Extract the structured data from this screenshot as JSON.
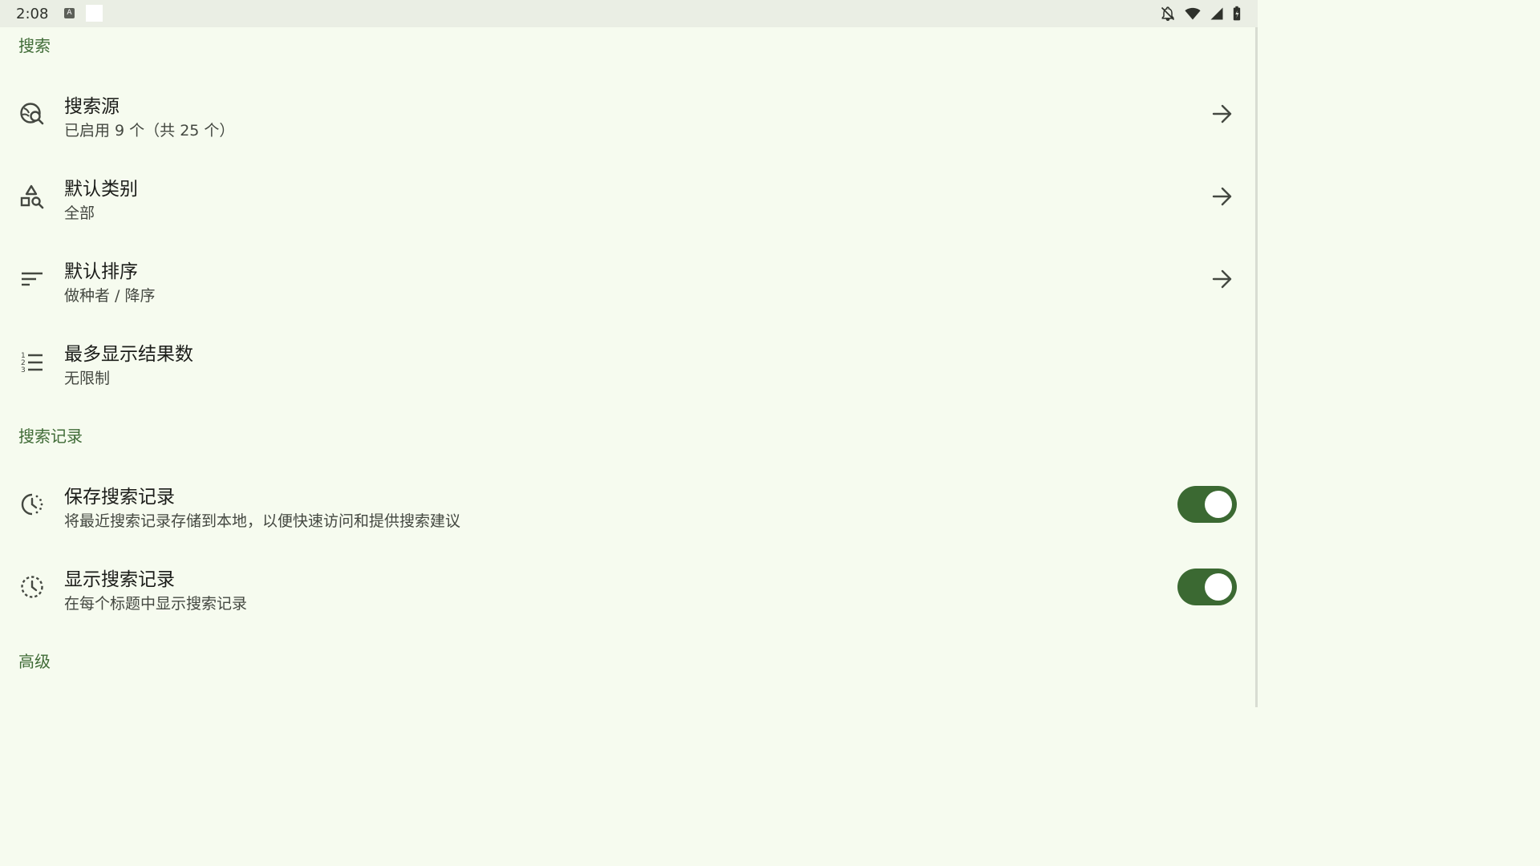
{
  "status_bar": {
    "time": "2:08",
    "a_icon_letter": "A",
    "icons": [
      "notifications-off-icon",
      "wifi-icon",
      "cellular-signal-icon",
      "battery-icon"
    ]
  },
  "sections": {
    "search": {
      "header": "搜索"
    },
    "history": {
      "header": "搜索记录"
    },
    "advanced": {
      "header": "高级"
    }
  },
  "items": {
    "search_sources": {
      "title": "搜索源",
      "summary": "已启用 9 个（共 25 个）",
      "icon": "travel-explore-icon"
    },
    "default_category": {
      "title": "默认类别",
      "summary": "全部",
      "icon": "category-search-icon"
    },
    "default_sort": {
      "title": "默认排序",
      "summary": "做种者 / 降序",
      "icon": "sort-icon"
    },
    "max_results": {
      "title": "最多显示结果数",
      "summary": "无限制",
      "icon": "format-list-numbered-icon"
    },
    "save_history": {
      "title": "保存搜索记录",
      "summary": "将最近搜索记录存储到本地，以便快速访问和提供搜索建议",
      "icon": "history-toggle-icon",
      "enabled": true
    },
    "show_history": {
      "title": "显示搜索记录",
      "summary": "在每个标题中显示搜索记录",
      "icon": "history-dotted-icon",
      "enabled": true
    }
  },
  "colors": {
    "background": "#f6fbef",
    "accent": "#3b6932",
    "section_header": "#3f6b36"
  }
}
